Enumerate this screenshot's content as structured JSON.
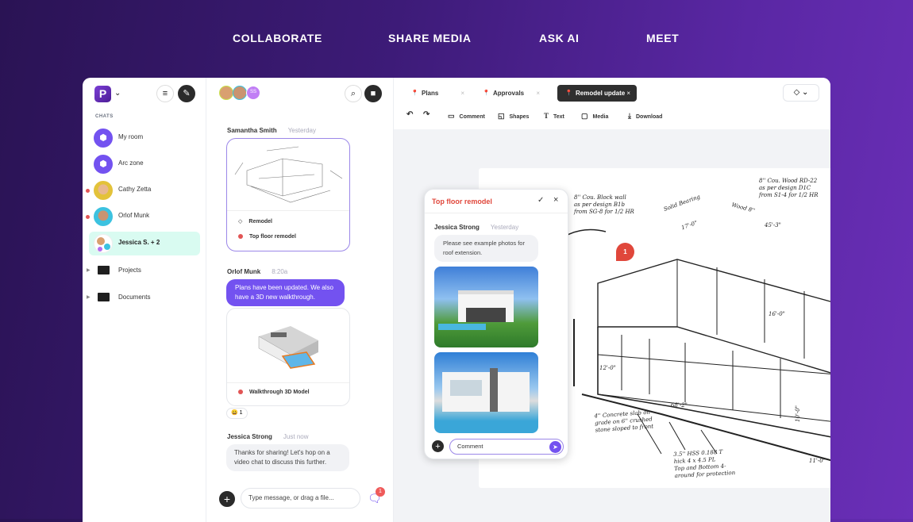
{
  "topnav": [
    "COLLABORATE",
    "SHARE MEDIA",
    "ASK AI",
    "MEET"
  ],
  "sidebar": {
    "logo": "P",
    "section": "CHATS",
    "items": [
      {
        "label": "My room",
        "icon": "cube-icon"
      },
      {
        "label": "Arc zone",
        "icon": "cube-icon"
      },
      {
        "label": "Cathy Zetta",
        "unread": true
      },
      {
        "label": "Orlof Munk",
        "unread": true
      },
      {
        "label": "Jessica S. + 2",
        "active": true
      }
    ],
    "folders": [
      "Projects",
      "Documents"
    ]
  },
  "chat": {
    "participants_initials": "SS",
    "messages": [
      {
        "author": "Samantha Smith",
        "time": "Yesterday",
        "attachment": {
          "tag": "Remodel",
          "title": "Top floor remodel"
        }
      },
      {
        "author": "Orlof Munk",
        "time": "8:20a",
        "text": "Plans have been updated. We also have a 3D new walkthrough.",
        "attachment": {
          "title": "Walkthrough 3D Model"
        },
        "reaction": {
          "emoji": "😀",
          "count": "1"
        }
      },
      {
        "author": "Jessica Strong",
        "time": "Just now",
        "text": "Thanks for sharing! Let's hop on a video chat to discuss this further."
      }
    ],
    "input_placeholder": "Type message, or drag a file...",
    "notif_count": "1"
  },
  "canvas": {
    "tabs": [
      {
        "label": "Plans"
      },
      {
        "label": "Approvals"
      },
      {
        "label": "Remodel update",
        "active": true
      }
    ],
    "tools": [
      "Comment",
      "Shapes",
      "Text",
      "Media",
      "Download"
    ],
    "marker": "1",
    "notes": [
      "8'' Cou. Block wall\nas per design B1b\nfrom SG-8 for 1/2 HR",
      "Solid Bearing",
      "17'-0\"",
      "Wood 8''",
      "45'-3\"",
      "8'' Cou. Wood RD-22\nas per design D1C\nfrom S1-4 for 1/2 HR",
      "16'-0\"",
      "12'-0\"",
      "68'-2\"",
      "4'' Concrete slab on\ngrade on 6'' crushed\nstone sloped to front",
      "3.5'' HSS 0.188 T\nhick 4 x 4.5 PL\nTop and Bottom 4-\naround for protection",
      "11'-0\"",
      "10'-0\""
    ]
  },
  "comment_popup": {
    "title": "Top floor remodel",
    "author": "Jessica Strong",
    "time": "Yesterday",
    "text": "Please see example photos for roof extension.",
    "input_placeholder": "Comment"
  },
  "colors": {
    "accent": "#7352f0",
    "unread": "#e25555",
    "active_bg": "#d9fbf1",
    "title_red": "#e0473b"
  }
}
